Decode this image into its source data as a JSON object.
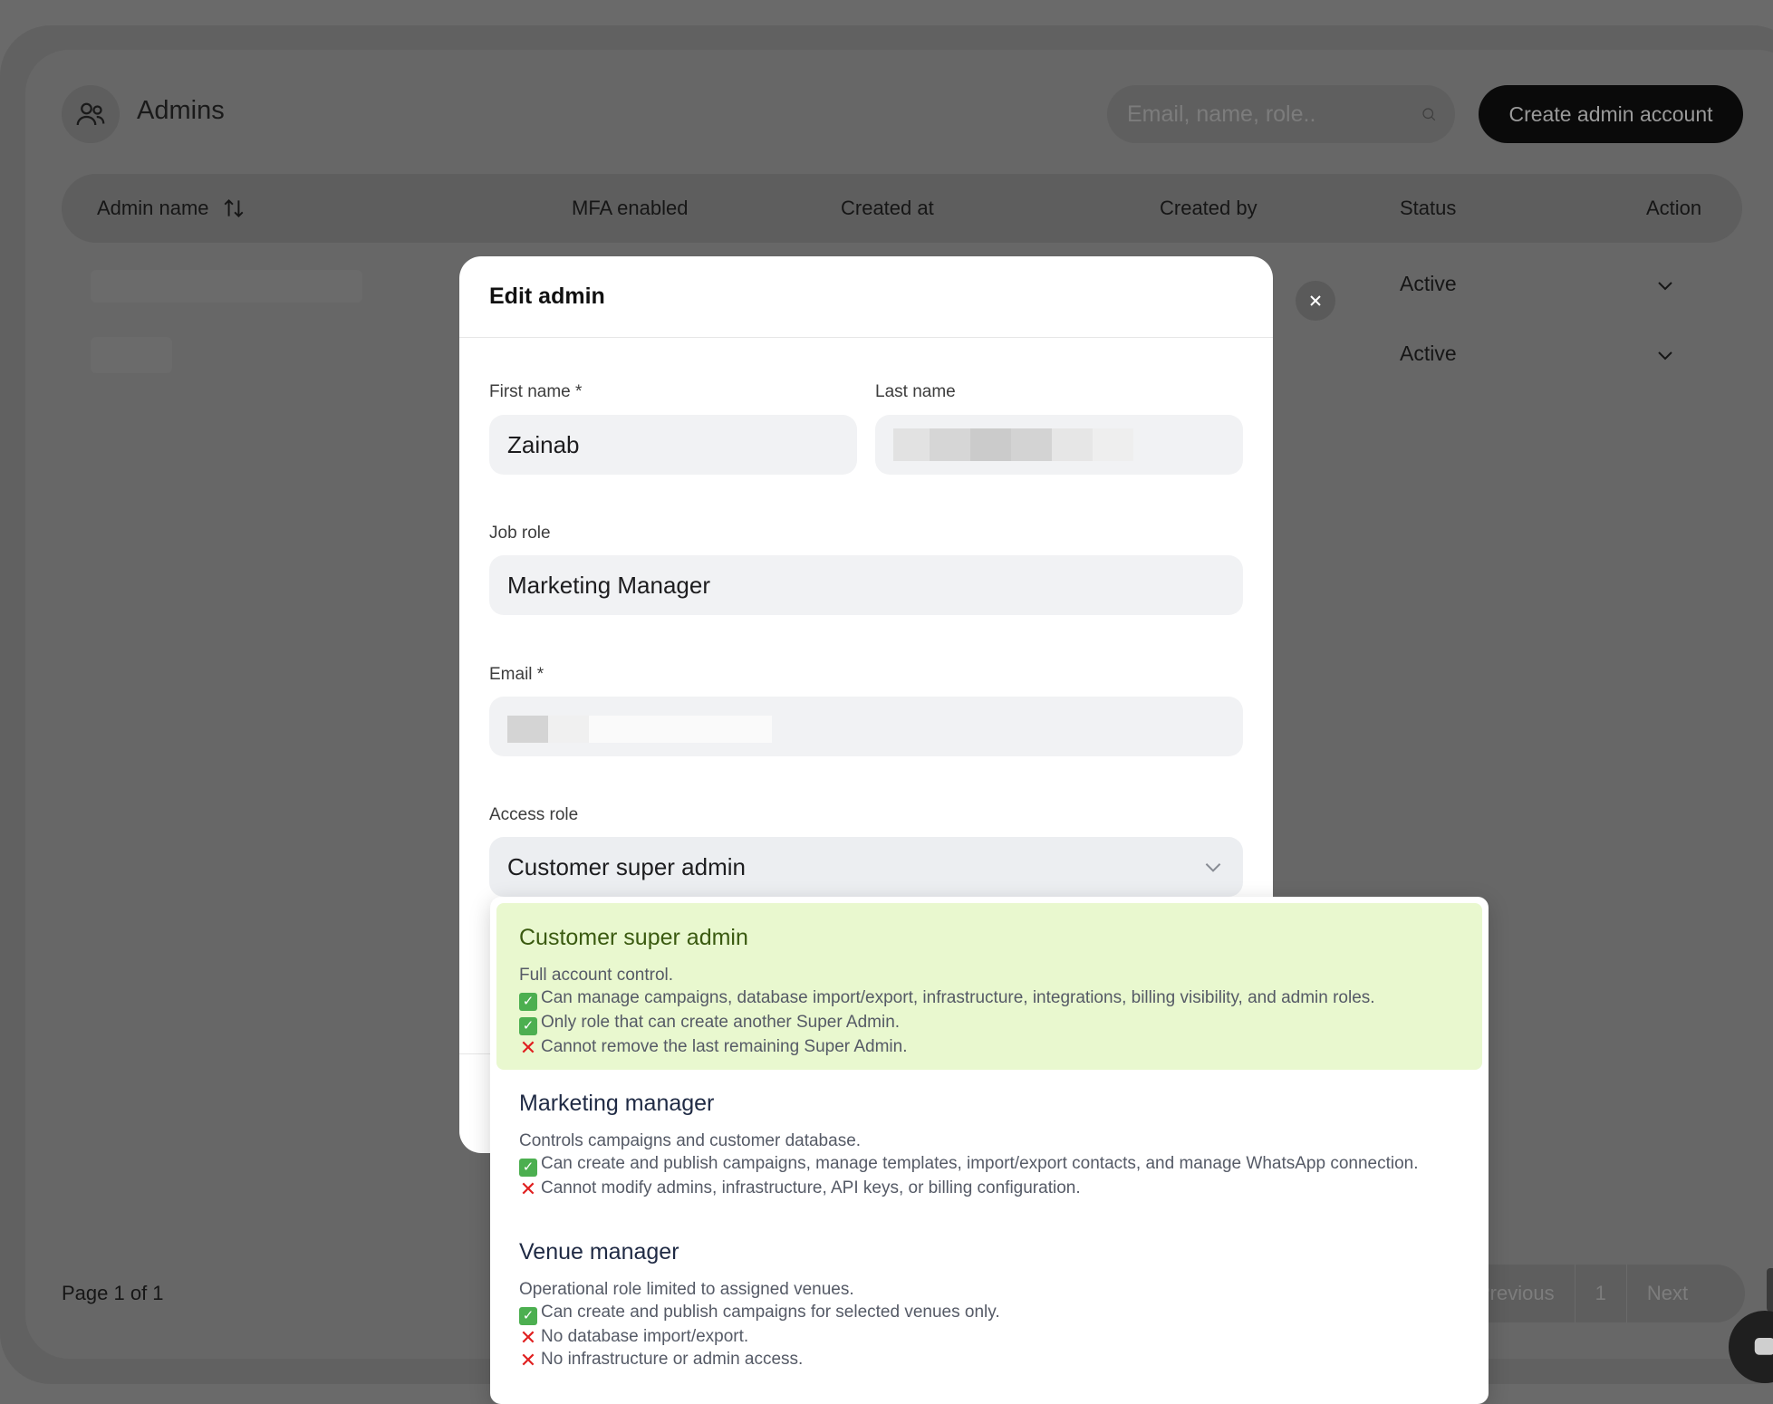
{
  "header": {
    "title": "Admins",
    "search_placeholder": "Email, name, role..",
    "create_button": "Create admin account"
  },
  "table": {
    "columns": [
      "Admin name",
      "MFA enabled",
      "Created at",
      "Created by",
      "Status",
      "Action"
    ],
    "rows": [
      {
        "status": "Active"
      },
      {
        "status": "Active"
      }
    ]
  },
  "footer": {
    "page_info": "Page 1 of 1",
    "previous": "Previous",
    "current_page": "1",
    "next": "Next"
  },
  "modal": {
    "title": "Edit admin",
    "first_name_label": "First name *",
    "first_name_value": "Zainab",
    "last_name_label": "Last name",
    "job_role_label": "Job role",
    "job_role_value": "Marketing Manager",
    "email_label": "Email *",
    "access_role_label": "Access role",
    "access_role_value": "Customer super admin"
  },
  "dropdown": {
    "options": [
      {
        "title": "Customer super admin",
        "selected": true,
        "lines": [
          {
            "mark": "none",
            "text": "Full account control."
          },
          {
            "mark": "ok",
            "text": "Can manage campaigns, database import/export, infrastructure, integrations, billing visibility, and admin roles."
          },
          {
            "mark": "ok",
            "text": "Only role that can create another Super Admin."
          },
          {
            "mark": "no",
            "text": "Cannot remove the last remaining Super Admin."
          }
        ]
      },
      {
        "title": "Marketing manager",
        "selected": false,
        "lines": [
          {
            "mark": "none",
            "text": "Controls campaigns and customer database."
          },
          {
            "mark": "ok",
            "text": "Can create and publish campaigns, manage templates, import/export contacts, and manage WhatsApp connection."
          },
          {
            "mark": "no",
            "text": "Cannot modify admins, infrastructure, API keys, or billing configuration."
          }
        ]
      },
      {
        "title": "Venue manager",
        "selected": false,
        "lines": [
          {
            "mark": "none",
            "text": "Operational role limited to assigned venues."
          },
          {
            "mark": "ok",
            "text": "Can create and publish campaigns for selected venues only."
          },
          {
            "mark": "no",
            "text": "No database import/export."
          },
          {
            "mark": "no",
            "text": "No infrastructure or admin access."
          }
        ]
      }
    ]
  },
  "icons": {
    "admins": "users-icon",
    "search": "search-icon",
    "sort": "sort-icon",
    "chevron": "chevron-down-icon",
    "close": "close-icon",
    "check": "check-mark-icon",
    "cross": "cross-mark-icon",
    "chat": "chat-icon"
  },
  "colors": {
    "selected_option_bg": "#e9f8cf",
    "primary_button": "#0a0a0a",
    "check_green": "#4caf50",
    "cross_red": "#e02020"
  }
}
